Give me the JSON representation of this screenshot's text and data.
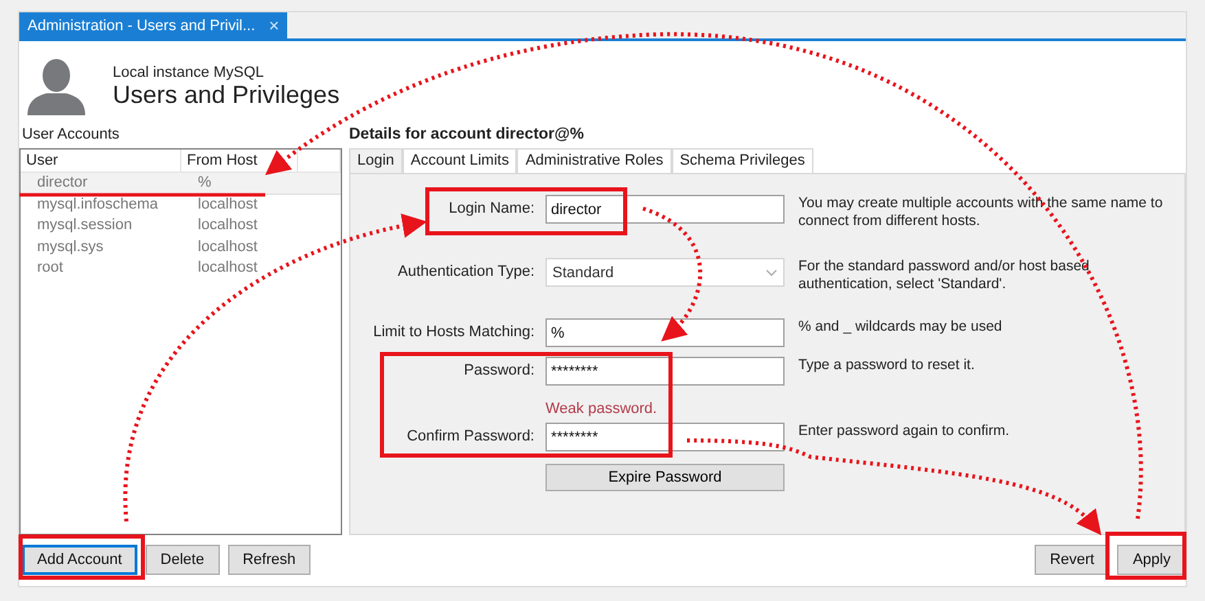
{
  "window": {
    "tab_title": "Administration - Users and Privil...",
    "close": "×"
  },
  "header": {
    "subtitle": "Local instance MySQL",
    "title": "Users and Privileges"
  },
  "user_accounts": {
    "label": "User Accounts",
    "columns": [
      "User",
      "From Host"
    ],
    "rows": [
      {
        "user": "director",
        "host": "%",
        "selected": true
      },
      {
        "user": "mysql.infoschema",
        "host": "localhost",
        "selected": false
      },
      {
        "user": "mysql.session",
        "host": "localhost",
        "selected": false
      },
      {
        "user": "mysql.sys",
        "host": "localhost",
        "selected": false
      },
      {
        "user": "root",
        "host": "localhost",
        "selected": false
      }
    ],
    "buttons": [
      {
        "label": "Add Account",
        "focused": true
      },
      {
        "label": "Delete",
        "focused": false
      },
      {
        "label": "Refresh",
        "focused": false
      }
    ]
  },
  "details": {
    "title": "Details for account director@%",
    "tabs": [
      {
        "label": "Login",
        "selected": true
      },
      {
        "label": "Account Limits",
        "selected": false
      },
      {
        "label": "Administrative Roles",
        "selected": false
      },
      {
        "label": "Schema Privileges",
        "selected": false
      }
    ],
    "fields": [
      {
        "kind": "input",
        "label": "Login Name:",
        "value": "director",
        "help": "You may create multiple accounts with the same name to connect from different hosts."
      },
      {
        "kind": "select",
        "label": "Authentication Type:",
        "value": "Standard",
        "help": "For the standard password and/or host based authentication, select 'Standard'."
      },
      {
        "kind": "input",
        "label": "Limit to Hosts Matching:",
        "value": "%",
        "help": "% and _ wildcards may be used"
      },
      {
        "kind": "input",
        "label": "Password:",
        "value": "********",
        "help": "Type a password to reset it."
      },
      {
        "kind": "note",
        "value": "Weak password."
      },
      {
        "kind": "input",
        "label": "Confirm Password:",
        "value": "********",
        "help": "Enter password again to confirm."
      },
      {
        "kind": "button",
        "value": "Expire Password"
      }
    ],
    "buttons": [
      {
        "label": "Revert"
      },
      {
        "label": "Apply"
      }
    ]
  }
}
